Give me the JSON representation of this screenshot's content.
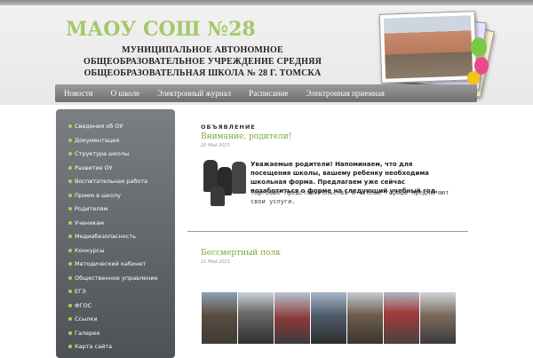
{
  "site": {
    "title": "МАОУ СОШ №28",
    "subtitle": "МУНИЦИПАЛЬНОЕ АВТОНОМНОЕ ОБЩЕОБРАЗОВАТЕЛЬНОЕ УЧРЕЖДЕНИЕ СРЕДНЯЯ ОБЩЕОБРАЗОВАТЕЛЬНАЯ ШКОЛА № 28 Г. ТОМСКА"
  },
  "nav": {
    "items": [
      "Новости",
      "О школе",
      "Электронный журнал",
      "Расписание",
      "Электронная приемная"
    ]
  },
  "sidebar": {
    "items": [
      "Сведения об ОУ",
      "Документация",
      "Структура школы",
      "Развитие ОУ",
      "Воспитательная работа",
      "Прием в школу",
      "Родителям",
      "Ученикам",
      "Медиабезопасность",
      "Конкурсы",
      "Методический кабинет",
      "Общественное управление",
      "ЕГЭ",
      "ФГОС",
      "Ссылки",
      "Галерея",
      "Карта сайта"
    ]
  },
  "main": {
    "section_label": "ОБЪЯВЛЕНИЕ",
    "posts": [
      {
        "title": "Внимание, родители!",
        "date": "20 Май 2015",
        "text_bold": "Уважаемые родители! Напоминаем, что для посещения школы, вашему ребенку необходима школьная форма. Предлагаем уже сейчас позаботиться о форме на следующий учебный год.",
        "text_regular": "Торговые представительства и ателье города предлагают свои услуги."
      },
      {
        "title": "Бессмертный полк",
        "date": "11 Май 2015"
      }
    ]
  },
  "colors": {
    "accent_green": "#a3c86b",
    "link_green": "#7aa73a",
    "nav_gray": "#7f7f7f",
    "sidebar_gray": "#5f6367"
  }
}
